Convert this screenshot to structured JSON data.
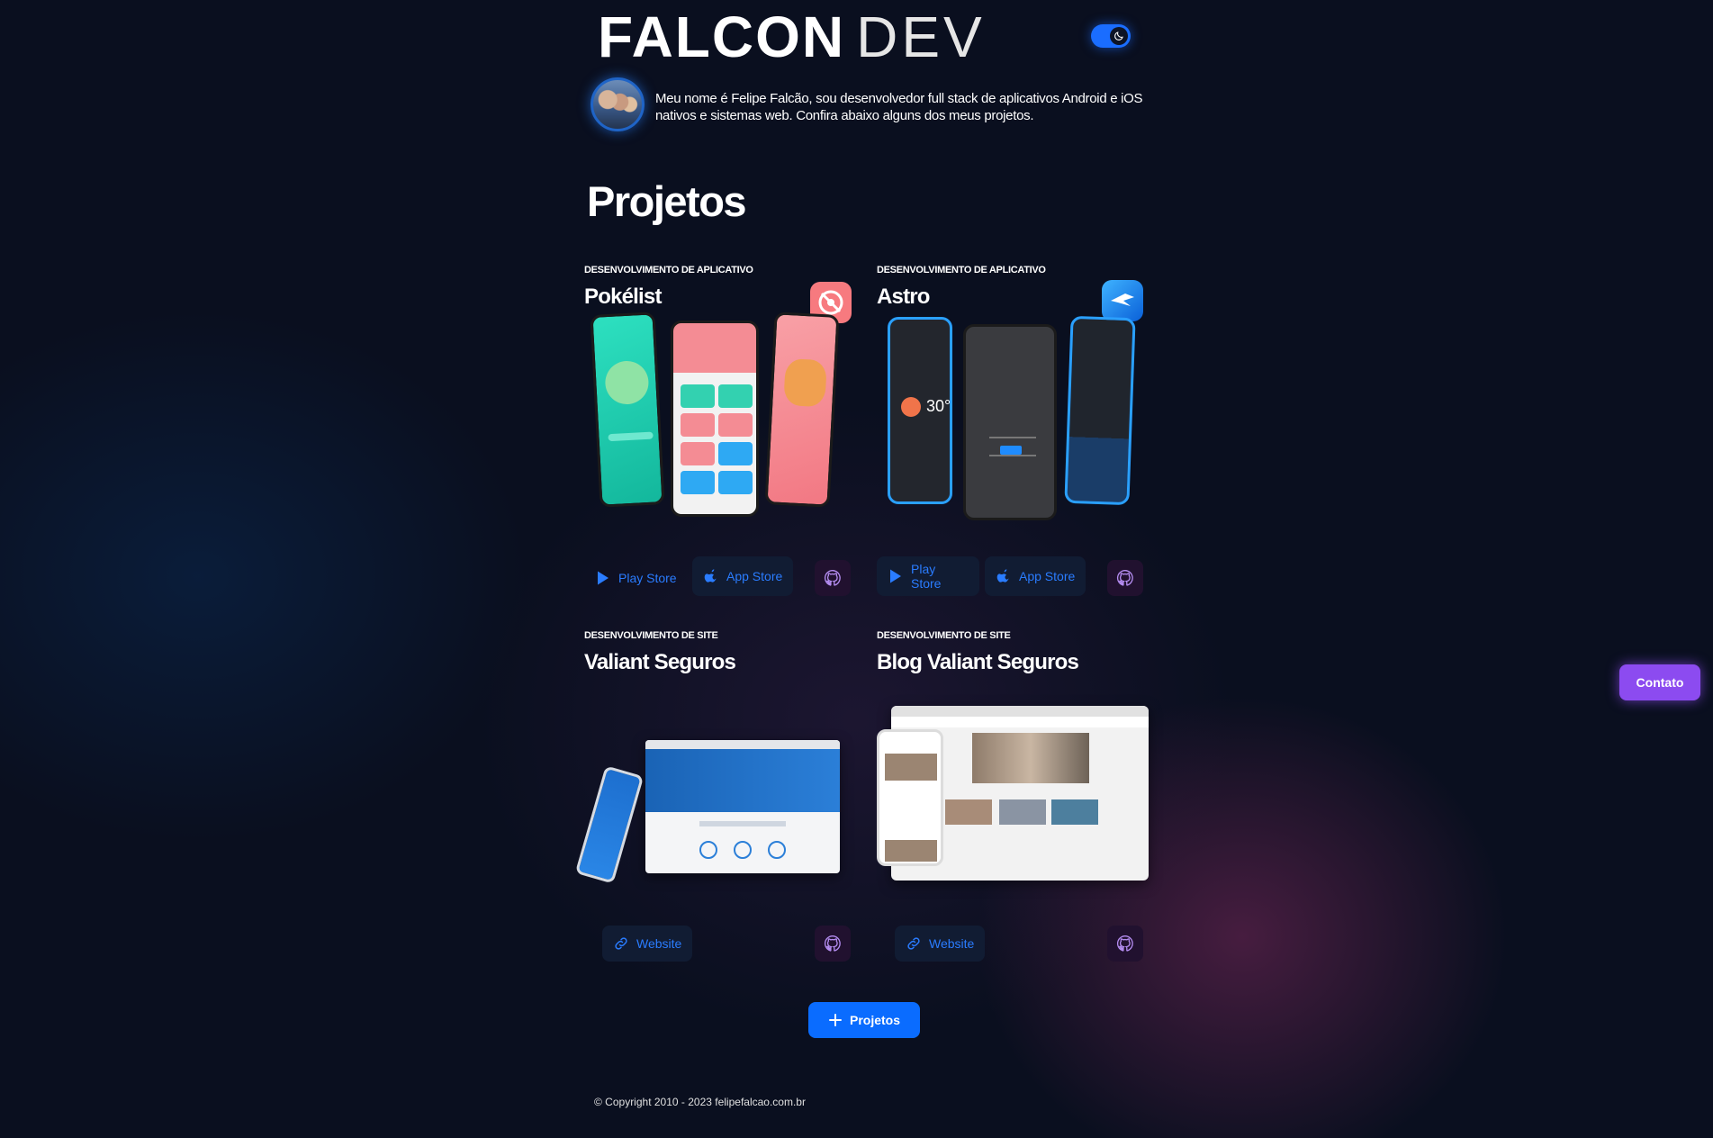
{
  "header": {
    "logo_bold": "FALCON",
    "logo_light": "DEV",
    "theme_toggle_state": "dark"
  },
  "intro": {
    "text": "Meu nome é Felipe Falcão, sou desenvolvedor full stack de aplicativos Android e iOS nativos e sistemas web. Confira abaixo alguns dos meus projetos."
  },
  "projects_title": "Projetos",
  "projects": [
    {
      "category": "DESENVOLVIMENTO DE APLICATIVO",
      "title": "Pokélist",
      "buttons": [
        "Play Store",
        "App Store"
      ]
    },
    {
      "category": "DESENVOLVIMENTO DE APLICATIVO",
      "title": "Astro",
      "buttons": [
        "Play Store",
        "App Store"
      ]
    },
    {
      "category": "DESENVOLVIMENTO DE SITE",
      "title": "Valiant Seguros",
      "buttons": [
        "Website"
      ]
    },
    {
      "category": "DESENVOLVIMENTO DE SITE",
      "title": "Blog Valiant Seguros",
      "buttons": [
        "Website"
      ]
    }
  ],
  "more_projects_label": "Projetos",
  "footer": {
    "copyright": "© Copyright 2010 - 2023 felipefalcao.com.br"
  },
  "contact_label": "Contato",
  "colors": {
    "background": "#0a0f1f",
    "accent_blue": "#0a6cff",
    "contact_purple": "#8c4bf0",
    "github_icon": "#b48cf0"
  },
  "icons": {
    "play_store": "play-store-icon",
    "app_store": "apple-icon",
    "website": "link-icon",
    "github": "github-icon",
    "theme": "moon-icon",
    "more": "plus-icon"
  }
}
